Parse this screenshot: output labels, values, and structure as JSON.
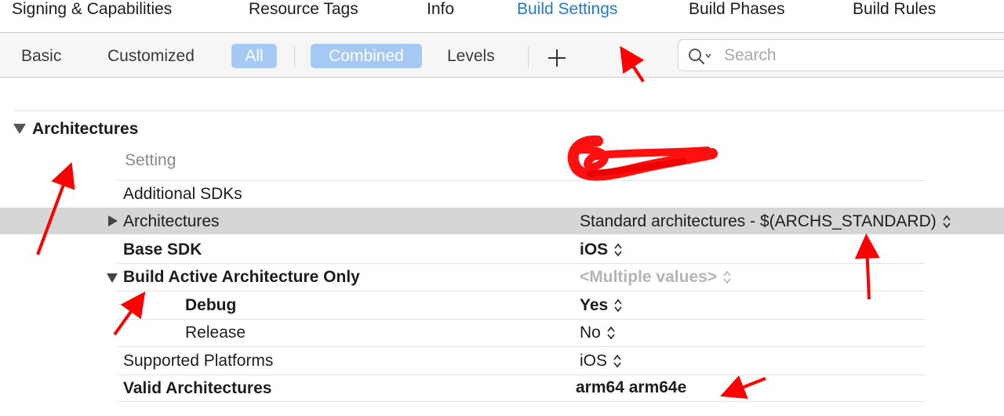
{
  "tabs": [
    {
      "label": "Signing & Capabilities",
      "active": false
    },
    {
      "label": "Resource Tags",
      "active": false
    },
    {
      "label": "Info",
      "active": false
    },
    {
      "label": "Build Settings",
      "active": true
    },
    {
      "label": "Build Phases",
      "active": false
    },
    {
      "label": "Build Rules",
      "active": false
    }
  ],
  "filters": {
    "basic": "Basic",
    "customized": "Customized",
    "all": "All",
    "combined": "Combined",
    "levels": "Levels",
    "add_icon": "plus-icon"
  },
  "search": {
    "placeholder": "Search",
    "icon": "magnifier-dropdown-icon"
  },
  "section": {
    "title": "Architectures",
    "column_setting": "Setting"
  },
  "rows": [
    {
      "setting": "Additional SDKs",
      "value": ""
    },
    {
      "setting": "Architectures",
      "value": "Standard architectures  -  $(ARCHS_STANDARD)",
      "stepper": true,
      "highlighted": true,
      "collapsed": true
    },
    {
      "setting": "Base SDK",
      "value": "iOS",
      "stepper": true,
      "bold": true
    },
    {
      "setting": "Build Active Architecture Only",
      "value": "<Multiple values>",
      "stepper": true,
      "bold": true,
      "expanded": true
    },
    {
      "setting": "Debug",
      "value": "Yes",
      "stepper": true,
      "bold": true,
      "child": true
    },
    {
      "setting": "Release",
      "value": "No",
      "stepper": true,
      "child": true
    },
    {
      "setting": "Supported Platforms",
      "value": "iOS",
      "stepper": true
    },
    {
      "setting": "Valid Architectures",
      "value": "arm64 arm64e",
      "bold": true
    }
  ],
  "colors": {
    "accent": "#1f7ad6",
    "selected_filter": "#a6c9f4",
    "highlight_row": "#d6d6d6",
    "annotation": "#ff0000"
  }
}
